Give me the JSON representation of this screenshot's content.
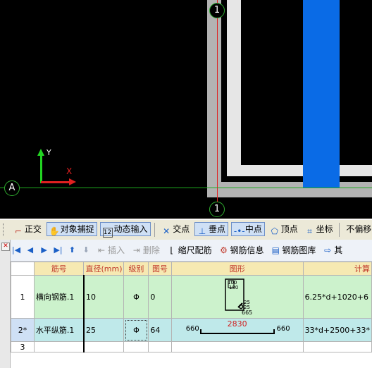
{
  "viewport": {
    "axis_top_label": "1",
    "axis_bottom_label": "1",
    "axis_left_label": "A",
    "ucs_x": "X",
    "ucs_y": "Y"
  },
  "snap_toolbar": {
    "ortho": "正交",
    "object_snap": "对象捕捉",
    "dynamic_input": "动态输入",
    "intersection": "交点",
    "perpendicular": "垂点",
    "midpoint": "中点",
    "vertex": "顶点",
    "coordinate": "坐标",
    "no_offset": "不偏移"
  },
  "grid_toolbar": {
    "insert": "插入",
    "delete": "删除",
    "scale_rebar": "缩尺配筋",
    "rebar_info": "钢筋信息",
    "rebar_library": "钢筋图库",
    "other": "其"
  },
  "table": {
    "headers": [
      "",
      "筋号",
      "直径(mm)",
      "级别",
      "图号",
      "图形",
      "计算"
    ],
    "rows": [
      {
        "index": "1",
        "name": "横向钢筋.1",
        "diameter": "10",
        "grade": "Φ",
        "figure_no": "0",
        "shape_labels": [
          "100",
          "180",
          "25",
          "25",
          "665"
        ],
        "formula": "6.25*d+1020+6"
      },
      {
        "index": "2*",
        "name": "水平纵筋.1",
        "diameter": "25",
        "grade": "Φ",
        "figure_no": "64",
        "shape_left": "660",
        "shape_mid": "2830",
        "shape_right": "660",
        "formula": "33*d+2500+33*"
      },
      {
        "index": "3",
        "name": "",
        "diameter": "",
        "grade": "",
        "figure_no": "",
        "formula": ""
      }
    ]
  }
}
